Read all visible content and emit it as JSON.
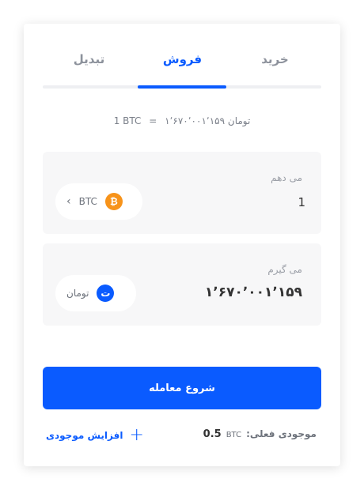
{
  "tabs": [
    {
      "label": "خرید"
    },
    {
      "label": "فروش"
    },
    {
      "label": "تبدیل"
    }
  ],
  "active_tab": "فروش",
  "rate": {
    "left": "1 BTC",
    "equals": "=",
    "right": "۱٬۶۷۰٬۰۰۱٬۱۵۹ تومان"
  },
  "give": {
    "label": "می دهم",
    "value": "1",
    "currency": "BTC",
    "coin_symbol": "₿",
    "coin_color": "#f7931a"
  },
  "receive": {
    "label": "می گیرم",
    "value": "۱٬۶۷۰٬۰۰۱٬۱۵۹",
    "currency": "تومان",
    "coin_symbol": "ت",
    "coin_color": "#0a5bff"
  },
  "submit_label": "شروع معامله",
  "balance": {
    "label": "موجودی فعلی:",
    "unit": "BTC",
    "value": "0.5"
  },
  "add_balance_label": "افزایش موجودی",
  "colors": {
    "primary": "#0a5bff",
    "muted": "#8d929c",
    "panel": "#f7f7f8"
  }
}
